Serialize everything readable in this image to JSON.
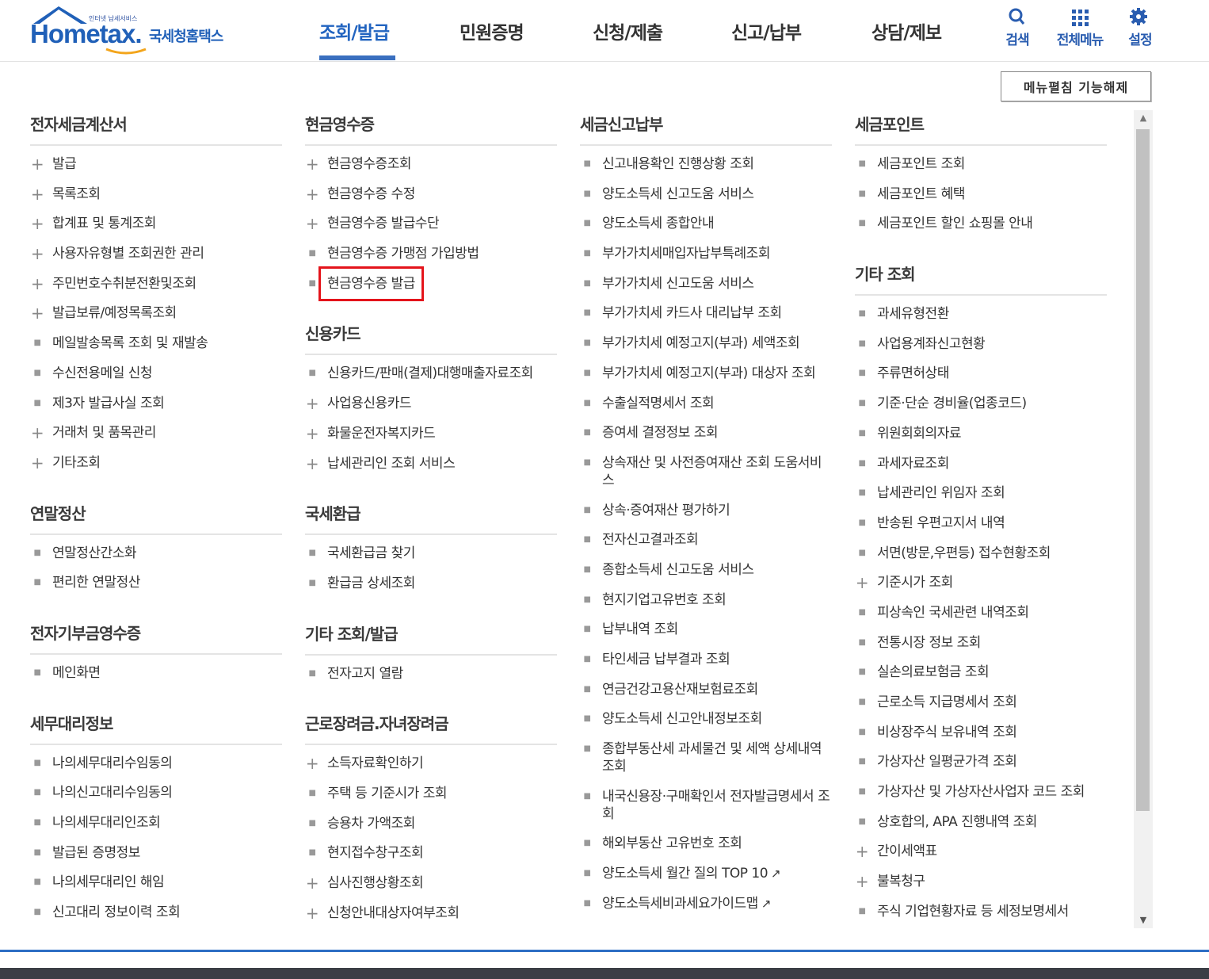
{
  "header": {
    "logo_sub": "인터넷 납세서비스",
    "logo_main": "Hometax.",
    "logo_kr": "국세청홈택스",
    "nav": [
      "조회/발급",
      "민원증명",
      "신청/제출",
      "신고/납부",
      "상담/제보"
    ],
    "active_nav": "조회/발급",
    "utils": [
      {
        "label": "검색",
        "icon": "search-icon"
      },
      {
        "label": "전체메뉴",
        "icon": "grid-icon"
      },
      {
        "label": "설정",
        "icon": "gear-icon"
      }
    ]
  },
  "fix_button": "메뉴펼침 기능해제",
  "columns": [
    {
      "sections": [
        {
          "title": "전자세금계산서",
          "items": [
            {
              "label": "발급",
              "marker": "plus"
            },
            {
              "label": "목록조회",
              "marker": "plus"
            },
            {
              "label": "합계표 및 통계조회",
              "marker": "plus"
            },
            {
              "label": "사용자유형별 조회권한 관리",
              "marker": "plus"
            },
            {
              "label": "주민번호수취분전환및조회",
              "marker": "plus"
            },
            {
              "label": "발급보류/예정목록조회",
              "marker": "plus"
            },
            {
              "label": "메일발송목록 조회 및 재발송",
              "marker": "dot"
            },
            {
              "label": "수신전용메일 신청",
              "marker": "dot"
            },
            {
              "label": "제3자 발급사실 조회",
              "marker": "dot"
            },
            {
              "label": "거래처 및 품목관리",
              "marker": "plus"
            },
            {
              "label": "기타조회",
              "marker": "plus"
            }
          ]
        },
        {
          "title": "연말정산",
          "items": [
            {
              "label": "연말정산간소화",
              "marker": "dot"
            },
            {
              "label": "편리한 연말정산",
              "marker": "dot"
            }
          ]
        },
        {
          "title": "전자기부금영수증",
          "items": [
            {
              "label": "메인화면",
              "marker": "dot"
            }
          ]
        },
        {
          "title": "세무대리정보",
          "items": [
            {
              "label": "나의세무대리수임동의",
              "marker": "dot"
            },
            {
              "label": "나의신고대리수임동의",
              "marker": "dot"
            },
            {
              "label": "나의세무대리인조회",
              "marker": "dot"
            },
            {
              "label": "발급된 증명정보",
              "marker": "dot"
            },
            {
              "label": "나의세무대리인 해임",
              "marker": "dot"
            },
            {
              "label": "신고대리 정보이력 조회",
              "marker": "dot"
            }
          ]
        }
      ]
    },
    {
      "sections": [
        {
          "title": "현금영수증",
          "items": [
            {
              "label": "현금영수증조회",
              "marker": "plus"
            },
            {
              "label": "현금영수증 수정",
              "marker": "plus"
            },
            {
              "label": "현금영수증 발급수단",
              "marker": "plus"
            },
            {
              "label": "현금영수증 가맹점 가입방법",
              "marker": "dot"
            },
            {
              "label": "현금영수증 발급",
              "marker": "dot",
              "highlight": true
            }
          ]
        },
        {
          "title": "신용카드",
          "items": [
            {
              "label": "신용카드/판매(결제)대행매출자료조회",
              "marker": "dot"
            },
            {
              "label": "사업용신용카드",
              "marker": "plus"
            },
            {
              "label": "화물운전자복지카드",
              "marker": "plus"
            },
            {
              "label": "납세관리인 조회 서비스",
              "marker": "plus"
            }
          ]
        },
        {
          "title": "국세환급",
          "items": [
            {
              "label": "국세환급금 찾기",
              "marker": "dot"
            },
            {
              "label": "환급금 상세조회",
              "marker": "dot"
            }
          ]
        },
        {
          "title": "기타 조회/발급",
          "items": [
            {
              "label": "전자고지 열람",
              "marker": "dot"
            }
          ]
        },
        {
          "title": "근로장려금.자녀장려금",
          "items": [
            {
              "label": "소득자료확인하기",
              "marker": "plus"
            },
            {
              "label": "주택 등 기준시가 조회",
              "marker": "dot"
            },
            {
              "label": "승용차 가액조회",
              "marker": "dot"
            },
            {
              "label": "현지접수창구조회",
              "marker": "dot"
            },
            {
              "label": "심사진행상황조회",
              "marker": "plus"
            },
            {
              "label": "신청안내대상자여부조회",
              "marker": "plus"
            }
          ]
        }
      ]
    },
    {
      "sections": [
        {
          "title": "세금신고납부",
          "items": [
            {
              "label": "신고내용확인 진행상황 조회",
              "marker": "dot"
            },
            {
              "label": "양도소득세 신고도움 서비스",
              "marker": "dot"
            },
            {
              "label": "양도소득세 종합안내",
              "marker": "dot"
            },
            {
              "label": "부가가치세매입자납부특례조회",
              "marker": "dot"
            },
            {
              "label": "부가가치세 신고도움 서비스",
              "marker": "dot"
            },
            {
              "label": "부가가치세 카드사 대리납부 조회",
              "marker": "dot"
            },
            {
              "label": "부가가치세 예정고지(부과) 세액조회",
              "marker": "dot"
            },
            {
              "label": "부가가치세 예정고지(부과) 대상자 조회",
              "marker": "dot"
            },
            {
              "label": "수출실적명세서 조회",
              "marker": "dot"
            },
            {
              "label": "증여세 결정정보 조회",
              "marker": "dot"
            },
            {
              "label": "상속재산 및 사전증여재산 조회 도움서비스",
              "marker": "dot"
            },
            {
              "label": "상속·증여재산 평가하기",
              "marker": "dot"
            },
            {
              "label": "전자신고결과조회",
              "marker": "dot"
            },
            {
              "label": "종합소득세 신고도움 서비스",
              "marker": "dot"
            },
            {
              "label": "현지기업고유번호 조회",
              "marker": "dot"
            },
            {
              "label": "납부내역 조회",
              "marker": "dot"
            },
            {
              "label": "타인세금 납부결과 조회",
              "marker": "dot"
            },
            {
              "label": "연금건강고용산재보험료조회",
              "marker": "dot"
            },
            {
              "label": "양도소득세 신고안내정보조회",
              "marker": "dot"
            },
            {
              "label": "종합부동산세 과세물건 및 세액 상세내역 조회",
              "marker": "dot"
            },
            {
              "label": "내국신용장·구매확인서 전자발급명세서 조회",
              "marker": "dot"
            },
            {
              "label": "해외부동산 고유번호 조회",
              "marker": "dot"
            },
            {
              "label": "양도소득세 월간 질의 TOP 10",
              "marker": "dot",
              "external": true
            },
            {
              "label": "양도소득세비과세요가이드맵",
              "marker": "dot",
              "external": true
            }
          ]
        }
      ]
    },
    {
      "sections": [
        {
          "title": "세금포인트",
          "items": [
            {
              "label": "세금포인트 조회",
              "marker": "dot"
            },
            {
              "label": "세금포인트 혜택",
              "marker": "dot"
            },
            {
              "label": "세금포인트 할인 쇼핑몰 안내",
              "marker": "dot"
            }
          ]
        },
        {
          "title": "기타 조회",
          "items": [
            {
              "label": "과세유형전환",
              "marker": "dot"
            },
            {
              "label": "사업용계좌신고현황",
              "marker": "dot"
            },
            {
              "label": "주류면허상태",
              "marker": "dot"
            },
            {
              "label": "기준·단순 경비율(업종코드)",
              "marker": "dot"
            },
            {
              "label": "위원회회의자료",
              "marker": "dot"
            },
            {
              "label": "과세자료조회",
              "marker": "dot"
            },
            {
              "label": "납세관리인 위임자 조회",
              "marker": "dot"
            },
            {
              "label": "반송된 우편고지서 내역",
              "marker": "dot"
            },
            {
              "label": "서면(방문,우편등) 접수현황조회",
              "marker": "dot"
            },
            {
              "label": "기준시가 조회",
              "marker": "plus"
            },
            {
              "label": "피상속인 국세관련 내역조회",
              "marker": "dot"
            },
            {
              "label": "전통시장 정보 조회",
              "marker": "dot"
            },
            {
              "label": "실손의료보험금 조회",
              "marker": "dot"
            },
            {
              "label": "근로소득 지급명세서 조회",
              "marker": "dot"
            },
            {
              "label": "비상장주식 보유내역 조회",
              "marker": "dot"
            },
            {
              "label": "가상자산 일평균가격 조회",
              "marker": "dot"
            },
            {
              "label": "가상자산 및 가상자산사업자 코드 조회",
              "marker": "dot"
            },
            {
              "label": "상호합의, APA 진행내역 조회",
              "marker": "dot"
            },
            {
              "label": "간이세액표",
              "marker": "plus"
            },
            {
              "label": "불복청구",
              "marker": "plus"
            },
            {
              "label": "주식 기업현황자료 등 세정보명세서",
              "marker": "dot"
            }
          ]
        }
      ]
    }
  ],
  "colors": {
    "brand": "#2060b8",
    "highlight": "#e4141b",
    "nav_active": "#2264c0"
  }
}
